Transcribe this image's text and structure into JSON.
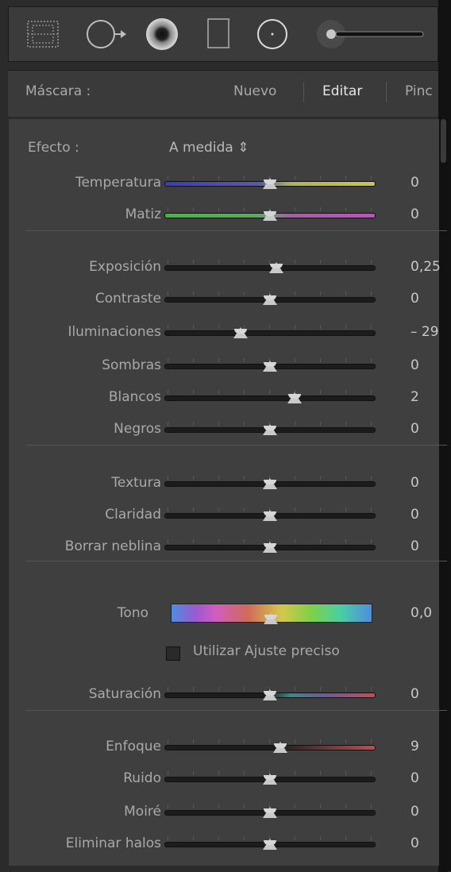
{
  "header": {
    "mask_label": "Máscara :",
    "tab_new": "Nuevo",
    "tab_edit": "Editar",
    "tab_brush": "Pinc"
  },
  "toolbar": {
    "tools": [
      "graduated-filter-icon",
      "spot-removal-icon",
      "radial-filter-icon",
      "crop-icon",
      "adjustment-circle-icon",
      "brush-size-slider-icon"
    ]
  },
  "efecto": {
    "label": "Efecto :",
    "value": "A medida",
    "arrow": "⇕"
  },
  "sliders": [
    {
      "key": "temperatura",
      "label": "Temperatura",
      "value": "0",
      "pos": 0.5,
      "track": "temp"
    },
    {
      "key": "matiz",
      "label": "Matiz",
      "value": "0",
      "pos": 0.5,
      "track": "tint"
    },
    {
      "key": "exposicion",
      "label": "Exposición",
      "value": "0,25",
      "pos": 0.53,
      "track": "plain"
    },
    {
      "key": "contraste",
      "label": "Contraste",
      "value": "0",
      "pos": 0.5,
      "track": "plain"
    },
    {
      "key": "iluminaciones",
      "label": "Iluminaciones",
      "value": "– 29",
      "pos": 0.36,
      "track": "plain"
    },
    {
      "key": "sombras",
      "label": "Sombras",
      "value": "0",
      "pos": 0.5,
      "track": "plain"
    },
    {
      "key": "blancos",
      "label": "Blancos",
      "value": "2",
      "pos": 0.62,
      "track": "plain"
    },
    {
      "key": "negros",
      "label": "Negros",
      "value": "0",
      "pos": 0.5,
      "track": "plain"
    },
    {
      "key": "textura",
      "label": "Textura",
      "value": "0",
      "pos": 0.5,
      "track": "plain"
    },
    {
      "key": "claridad",
      "label": "Claridad",
      "value": "0",
      "pos": 0.5,
      "track": "plain"
    },
    {
      "key": "borrar_neblina",
      "label": "Borrar neblina",
      "value": "0",
      "pos": 0.5,
      "track": "plain"
    },
    {
      "key": "saturacion",
      "label": "Saturación",
      "value": "0",
      "pos": 0.5,
      "track": "sat"
    },
    {
      "key": "enfoque",
      "label": "Enfoque",
      "value": "9",
      "pos": 0.55,
      "track": "sharp"
    },
    {
      "key": "ruido",
      "label": "Ruido",
      "value": "0",
      "pos": 0.5,
      "track": "plain"
    },
    {
      "key": "moire",
      "label": "Moiré",
      "value": "0",
      "pos": 0.5,
      "track": "plain"
    },
    {
      "key": "eliminar_halos",
      "label": "Eliminar halos",
      "value": "0",
      "pos": 0.5,
      "track": "plain"
    }
  ],
  "tono": {
    "label": "Tono",
    "value": "0,0",
    "pos": 0.5
  },
  "ajuste_preciso": {
    "label": "Utilizar Ajuste preciso",
    "checked": false
  }
}
